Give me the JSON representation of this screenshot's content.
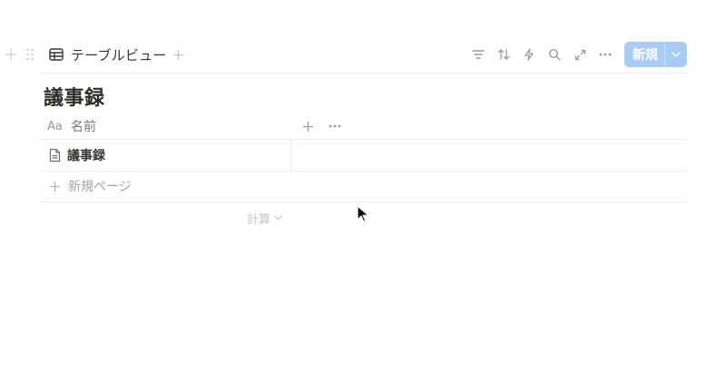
{
  "view_tab": {
    "label": "テーブルビュー",
    "icon": "table-icon"
  },
  "toolbar": {
    "icons": [
      "filter-icon",
      "sort-icon",
      "automation-icon",
      "search-icon",
      "expand-icon",
      "more-icon"
    ],
    "new_label": "新規"
  },
  "database": {
    "title": "議事録"
  },
  "columns": [
    {
      "icon_text": "Aa",
      "name": "名前"
    }
  ],
  "rows": [
    {
      "title": "議事録",
      "icon": "page-icon"
    }
  ],
  "new_page_label": "新規ページ",
  "calculate_label": "計算",
  "colors": {
    "accent": "#a9cdf2",
    "text": "#37352f",
    "muted": "#a5a4a1",
    "divider": "#ececec"
  }
}
